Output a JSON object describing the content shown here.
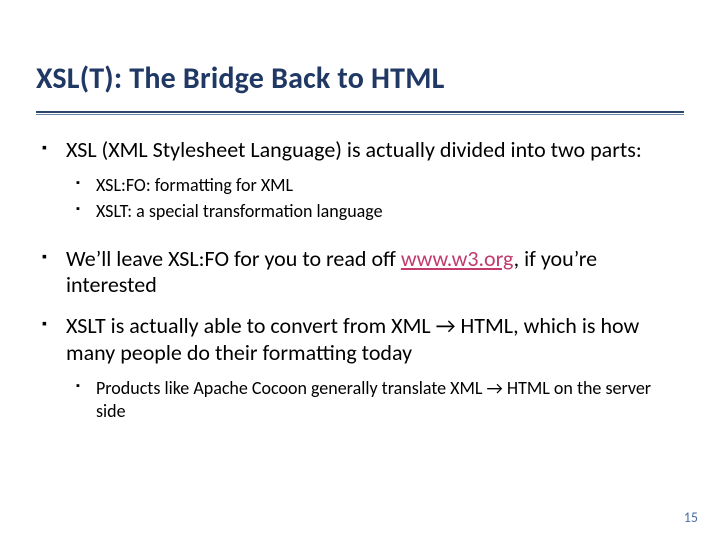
{
  "title": "XSL(T):  The Bridge Back to HTML",
  "bullets": {
    "b1": "XSL (XML Stylesheet Language) is actually divided into two parts:",
    "b1_sub": {
      "s1": "XSL:FO:  formatting for XML",
      "s2": "XSLT:  a special transformation language"
    },
    "b2_pre": "We’ll leave XSL:FO for you to read off ",
    "b2_link": "www.w3.org",
    "b2_post": ", if you’re interested",
    "b3": "XSLT is actually able to convert from XML → HTML, which is how many people do their formatting today",
    "b3_sub": {
      "s1": "Products like Apache Cocoon generally translate XML → HTML on the server side"
    }
  },
  "page_number": "15"
}
